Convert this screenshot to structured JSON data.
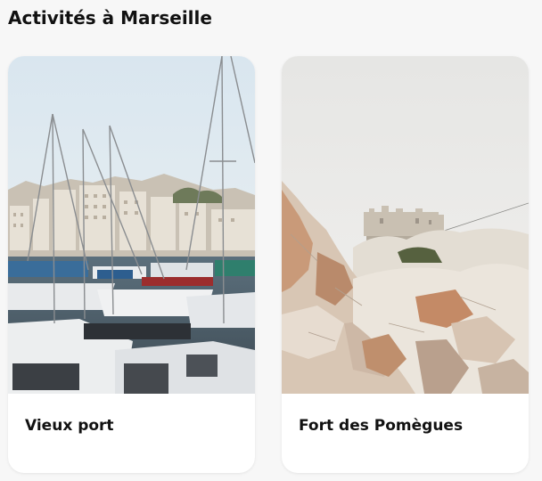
{
  "page": {
    "title": "Activités à Marseille"
  },
  "cards": [
    {
      "label": "Vieux port",
      "image": "marina-boats-photo"
    },
    {
      "label": "Fort des Pomègues",
      "image": "rocky-fort-photo"
    }
  ]
}
